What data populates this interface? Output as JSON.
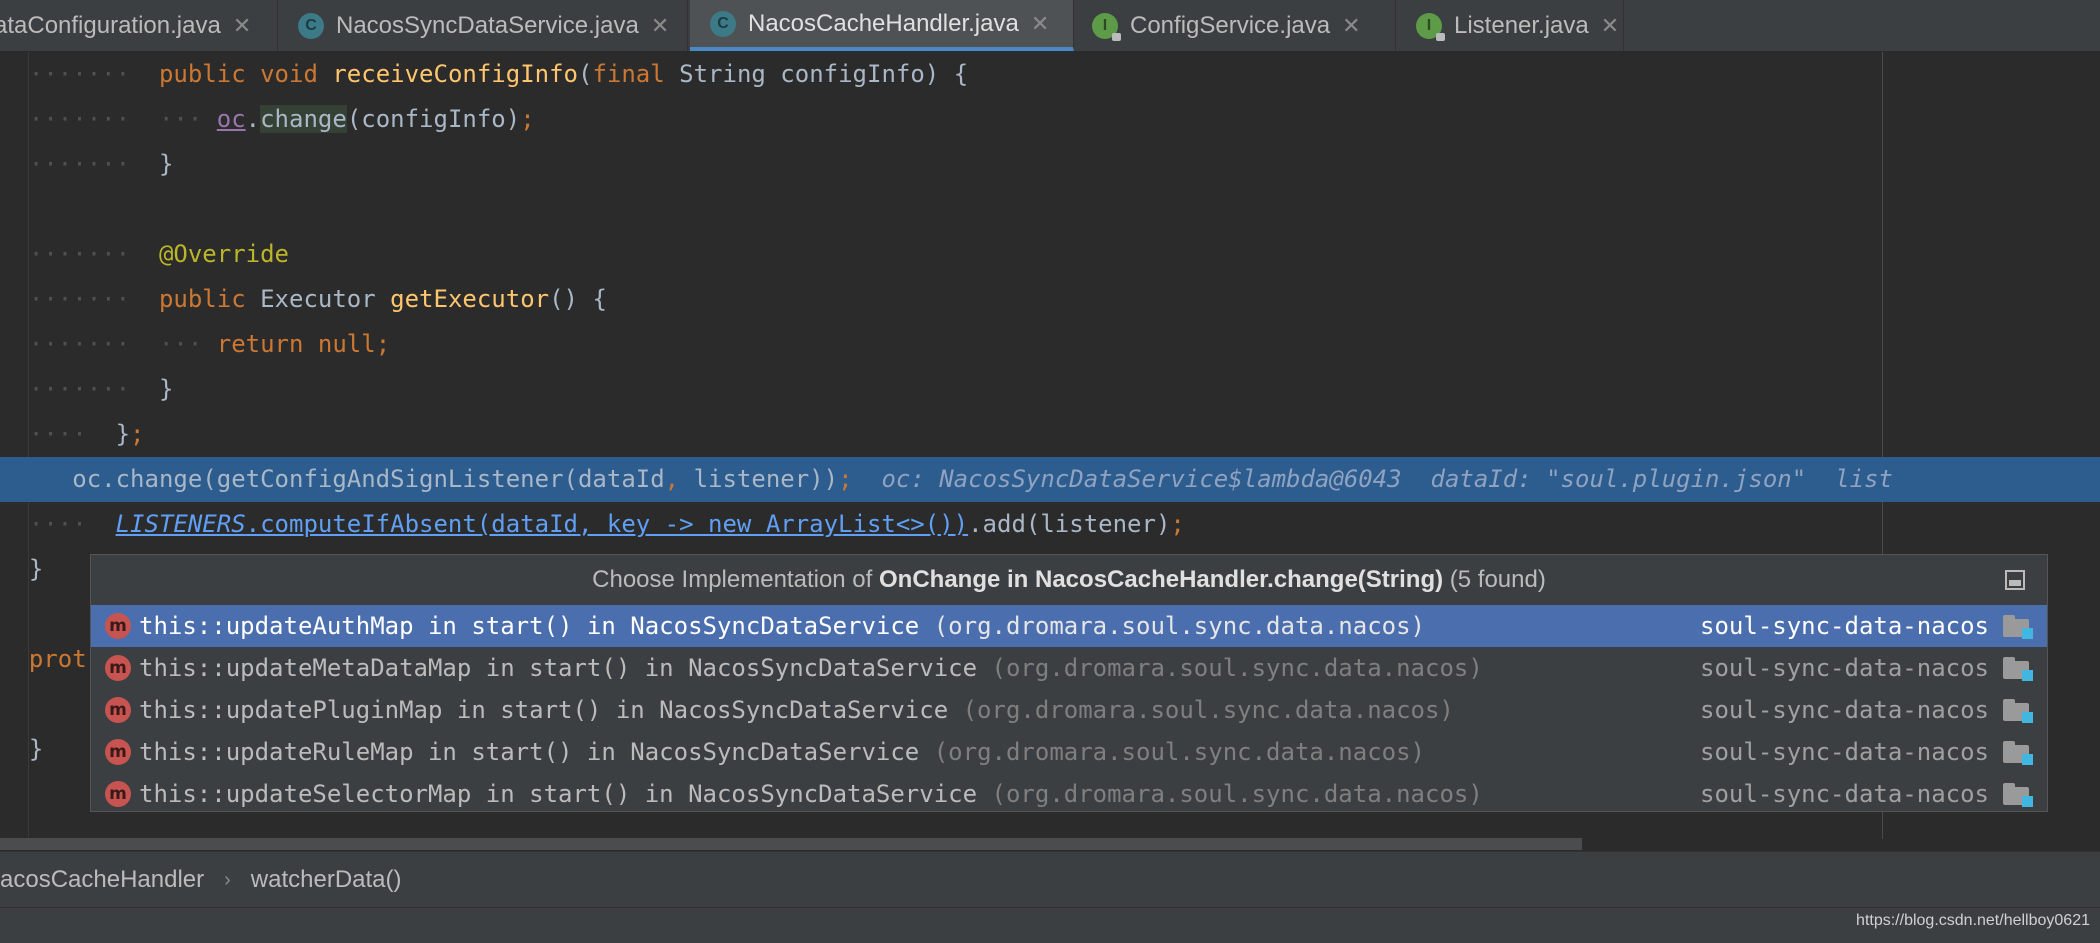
{
  "tabs": [
    {
      "label": "ataConfiguration.java",
      "icon": "class-icon",
      "active": false
    },
    {
      "label": "NacosSyncDataService.java",
      "icon": "class-icon",
      "active": false
    },
    {
      "label": "NacosCacheHandler.java",
      "icon": "class-icon",
      "active": true
    },
    {
      "label": "ConfigService.java",
      "icon": "interface-icon",
      "active": false
    },
    {
      "label": "Listener.java",
      "icon": "interface-icon",
      "active": false
    }
  ],
  "tab_icon_letters": {
    "class": "C",
    "interface": "I"
  },
  "tab_close_glyph": "✕",
  "code": {
    "line1": {
      "k1": "public",
      "k2": "void",
      "fn": "receiveConfigInfo",
      "open": "(",
      "k3": "final",
      "rest": " String configInfo) {"
    },
    "line2": {
      "obj": "oc",
      "dot": ".",
      "method": "change",
      "args": "(configInfo)",
      "semi": ";"
    },
    "line3": "}",
    "line5": "@Override",
    "line6": {
      "k1": "public",
      "type": " Executor ",
      "fn": "getExecutor",
      "rest": "() {"
    },
    "line7": {
      "k1": "return",
      "k2": "null",
      "semi": ";"
    },
    "line8": "}",
    "line9": {
      "text": "}",
      "semi": ";"
    },
    "line10": {
      "pre": "oc.change(getConfigAndSignListener(dataId",
      "comma": ",",
      "post": " listener))",
      "semi": ";",
      "hint": "oc: NacosSyncDataService$lambda@6043  dataId: \"soul.plugin.json\"  list"
    },
    "line11": {
      "static": "LISTENERS",
      "call": ".computeIfAbsent(dataId, key -> new ArrayList<>())",
      "rest": ".add(listener)",
      "semi": ";"
    },
    "line12": "}",
    "line13": "prot",
    "line14": "}"
  },
  "popup": {
    "title_prefix": "Choose Implementation of ",
    "title_bold": "OnChange in NacosCacheHandler.change(String)",
    "title_suffix": " (5 found)",
    "icon_letter": "m",
    "items": [
      {
        "method": "this::updateAuthMap in start() in NacosSyncDataService",
        "package": "(org.dromara.soul.sync.data.nacos)",
        "module": "soul-sync-data-nacos",
        "selected": true
      },
      {
        "method": "this::updateMetaDataMap in start() in NacosSyncDataService",
        "package": "(org.dromara.soul.sync.data.nacos)",
        "module": "soul-sync-data-nacos",
        "selected": false
      },
      {
        "method": "this::updatePluginMap in start() in NacosSyncDataService",
        "package": "(org.dromara.soul.sync.data.nacos)",
        "module": "soul-sync-data-nacos",
        "selected": false
      },
      {
        "method": "this::updateRuleMap in start() in NacosSyncDataService",
        "package": "(org.dromara.soul.sync.data.nacos)",
        "module": "soul-sync-data-nacos",
        "selected": false
      },
      {
        "method": "this::updateSelectorMap in start() in NacosSyncDataService",
        "package": "(org.dromara.soul.sync.data.nacos)",
        "module": "soul-sync-data-nacos",
        "selected": false
      }
    ]
  },
  "breadcrumb": {
    "class": "acosCacheHandler",
    "separator": "›",
    "method": "watcherData()"
  },
  "watermark": "https://blog.csdn.net/hellboy0621",
  "colors": {
    "accent": "#4a88c7",
    "selection": "#4b6eaf",
    "current_line": "#2d5c8f",
    "keyword": "#cc7832",
    "function": "#ffc66d"
  }
}
